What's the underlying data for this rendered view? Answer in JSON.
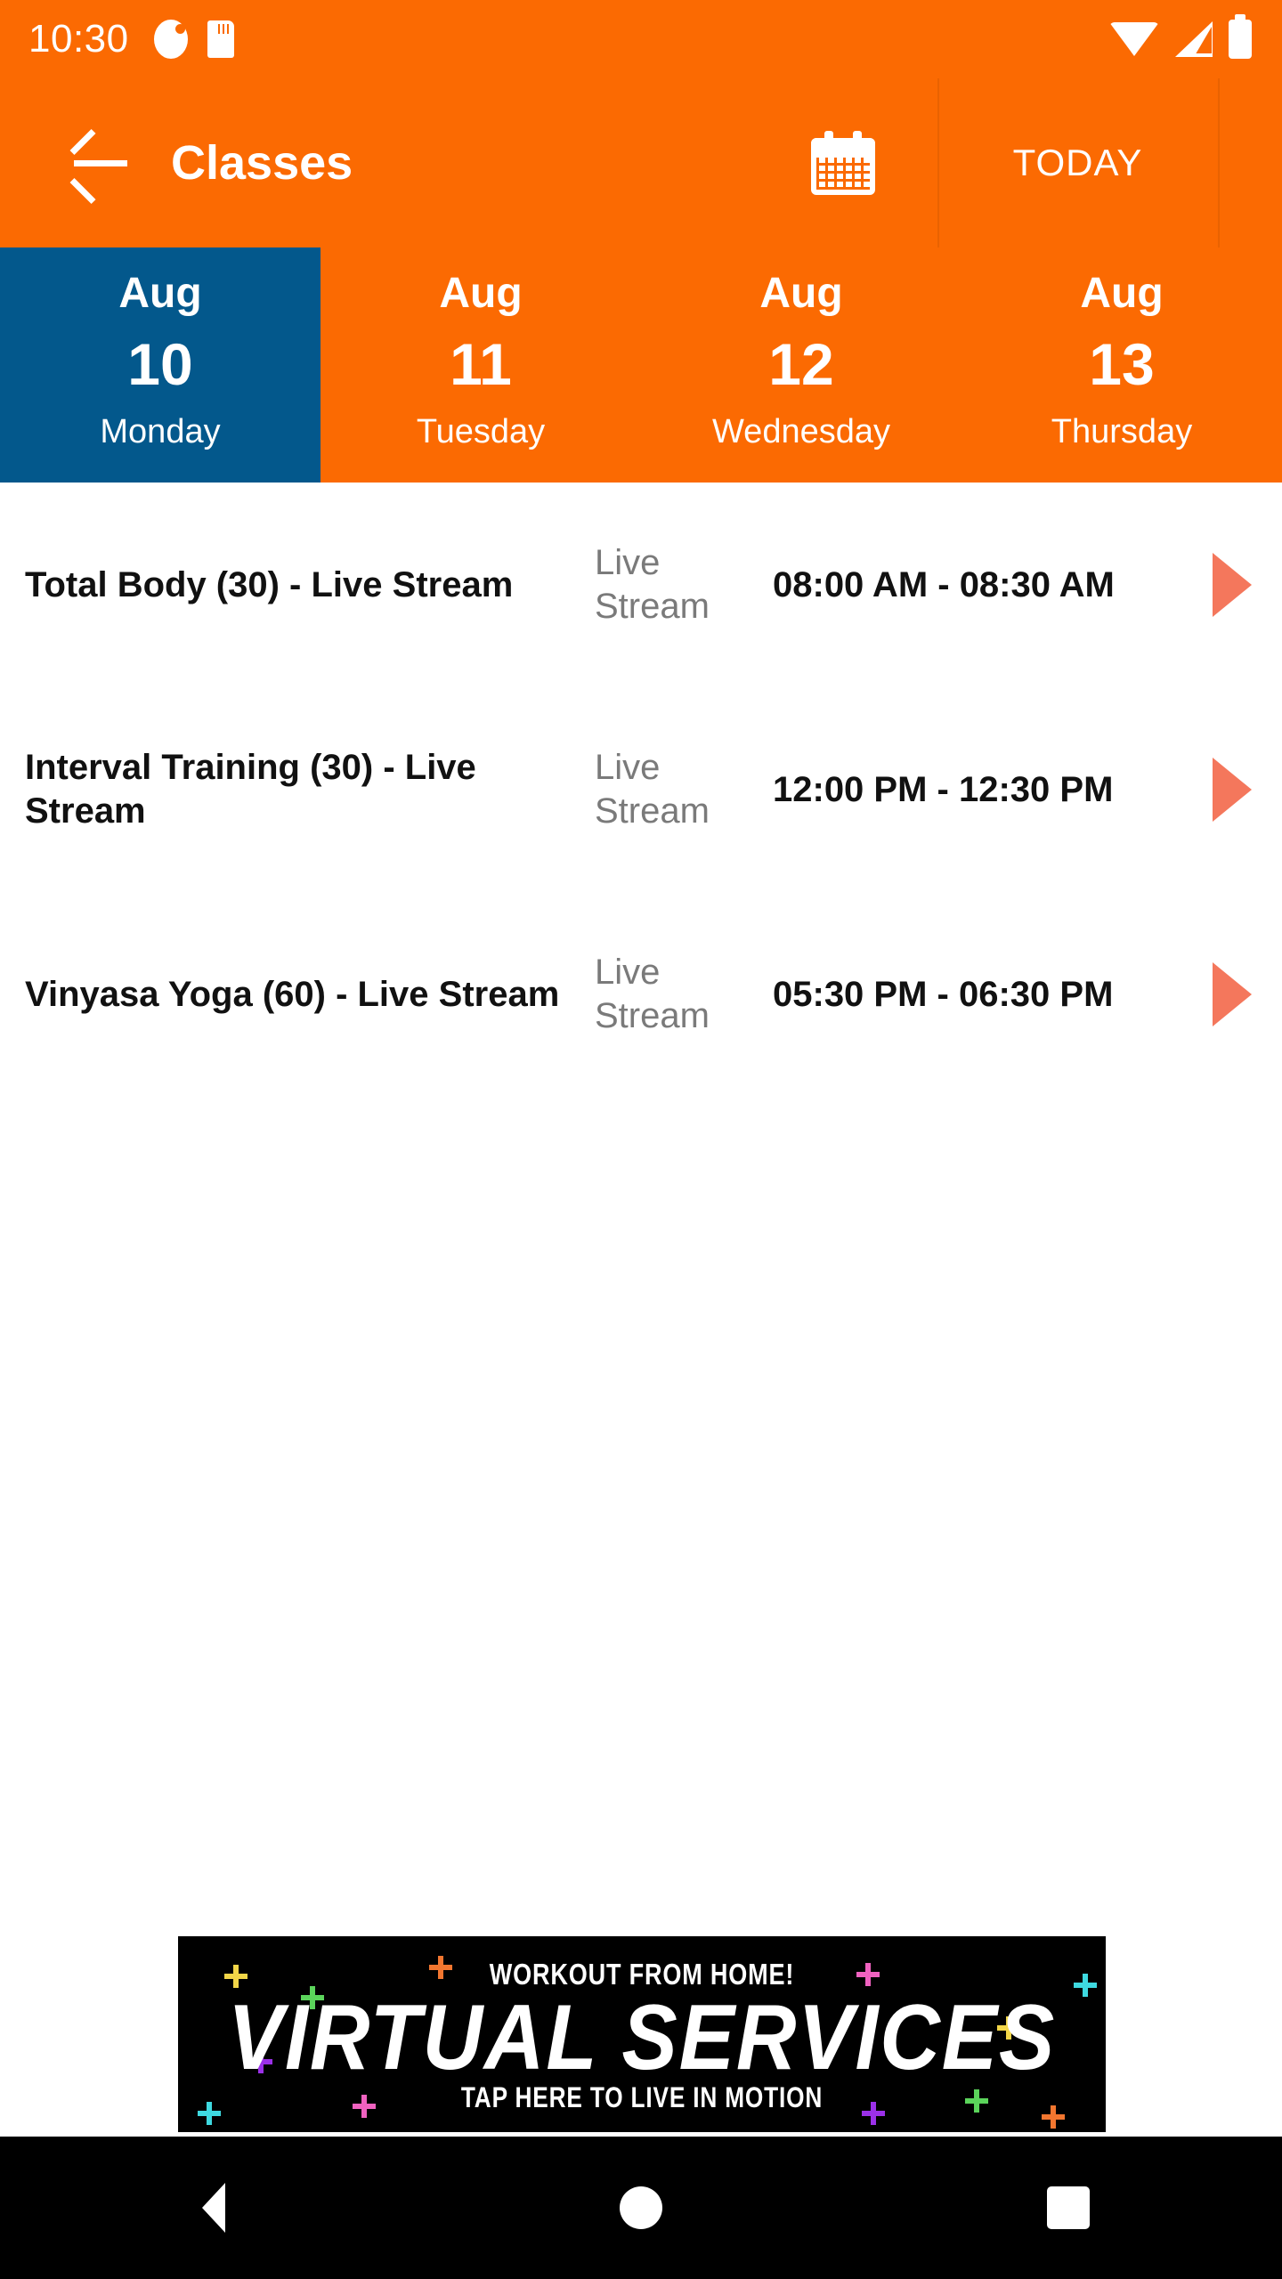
{
  "status_bar": {
    "clock": "10:30",
    "left_icons": [
      "do-not-disturb-icon",
      "sd-card-icon"
    ],
    "right_icons": [
      "wifi-icon",
      "cellular-signal-icon",
      "battery-icon"
    ]
  },
  "app_bar": {
    "back_icon": "arrow-back-icon",
    "title": "Classes",
    "calendar_icon": "calendar-icon",
    "today_label": "TODAY"
  },
  "colors": {
    "brand_orange": "#FB6A02",
    "selected_blue": "#03588C",
    "arrow_coral": "#F4775C",
    "secondary_text": "#7A7A7A",
    "primary_text": "#111111"
  },
  "date_strip": [
    {
      "month": "Aug",
      "day": "10",
      "weekday": "Monday",
      "selected": true
    },
    {
      "month": "Aug",
      "day": "11",
      "weekday": "Tuesday",
      "selected": false
    },
    {
      "month": "Aug",
      "day": "12",
      "weekday": "Wednesday",
      "selected": false
    },
    {
      "month": "Aug",
      "day": "13",
      "weekday": "Thursday",
      "selected": false
    }
  ],
  "classes": [
    {
      "name": "Total Body (30) - Live Stream",
      "type": "Live Stream",
      "time": "08:00 AM - 08:30 AM",
      "arrow_icon": "play-arrow-icon"
    },
    {
      "name": "Interval Training (30) - Live Stream",
      "type": "Live Stream",
      "time": "12:00 PM - 12:30 PM",
      "arrow_icon": "play-arrow-icon"
    },
    {
      "name": "Vinyasa Yoga (60) - Live Stream",
      "type": "Live Stream",
      "time": "05:30 PM - 06:30 PM",
      "arrow_icon": "play-arrow-icon"
    }
  ],
  "banner_ad": {
    "headline": "WORKOUT FROM HOME!",
    "title": "VIRTUAL SERVICES",
    "call_to_action": "TAP HERE TO LIVE IN MOTION",
    "sparkle_colors": [
      "#F2D648",
      "#5BD45B",
      "#F2762F",
      "#F062C0",
      "#3ED9E0",
      "#9B30E8",
      "#F2D648",
      "#3ED9E0",
      "#F062C0",
      "#9B30E8",
      "#5BD45B",
      "#F2762F"
    ]
  },
  "nav_bar": {
    "back_icon": "nav-back-icon",
    "home_icon": "nav-home-icon",
    "recents_icon": "nav-recents-icon"
  }
}
